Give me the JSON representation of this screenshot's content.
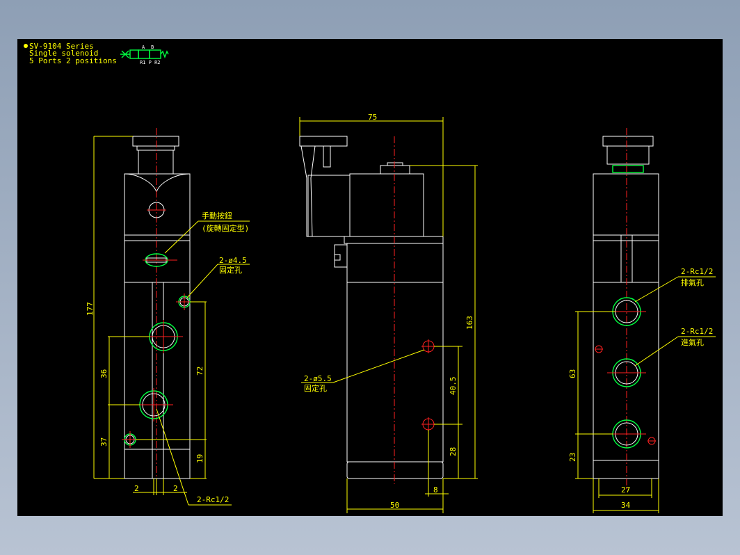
{
  "title_block": {
    "series": "SV-9104 Series",
    "type": "Single solenoid",
    "ports": "5 Ports 2 positions",
    "symbol_labels": {
      "a": "A",
      "b": "B",
      "bottom": "R1 P R2"
    }
  },
  "colors": {
    "background": "#000000",
    "outline": "#ffffff",
    "dimension": "#ffff00",
    "centerline": "#ff2020",
    "port": "#00ff40"
  },
  "front_view": {
    "dim_height": "177",
    "dim_port_spacing": "36",
    "dim_port_bottom": "37",
    "dim_hole_spacing": "72",
    "dim_hole_bottom": "19",
    "dim_offset_left": "2",
    "dim_offset_right": "2",
    "manual_button_label": "手動按鈕",
    "manual_button_sub": "(旋轉固定型)",
    "mount_hole_label": "2-ø4.5",
    "mount_hole_sub": "固定孔",
    "port_label": "2-Rc1/2"
  },
  "side_view": {
    "dim_width_top": "75",
    "dim_height": "163",
    "dim_hole_spacing": "40.5",
    "dim_hole_bottom": "28",
    "dim_hole_edge": "8",
    "dim_width_bottom": "50",
    "mount_hole_label": "2-ø5.5",
    "mount_hole_sub": "固定孔"
  },
  "back_view": {
    "exhaust_label": "2-Rc1/2",
    "exhaust_sub": "排氣孔",
    "inlet_label": "2-Rc1/2",
    "inlet_sub": "進氣孔",
    "dim_port_spacing": "63",
    "dim_port_bottom": "23",
    "dim_inner_width": "27",
    "dim_width": "34"
  }
}
